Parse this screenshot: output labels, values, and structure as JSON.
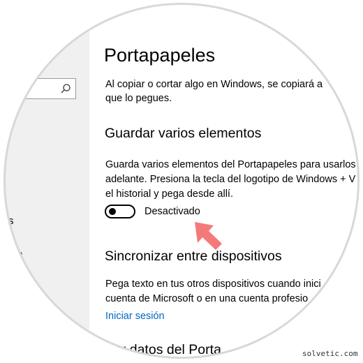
{
  "sidebar": {
    "search": {
      "placeholder": ""
    },
    "items": [
      {
        "label": "s"
      },
      {
        "label": "n"
      }
    ]
  },
  "main": {
    "title": "Portapapeles",
    "intro_lines": [
      "Al copiar o cortar algo en Windows, se copiará a",
      "que lo pegues."
    ],
    "history": {
      "title": "Guardar varios elementos",
      "description_lines": [
        "Guarda varios elementos del Portapapeles para usarlos",
        "adelante. Presiona la tecla del logotipo de Windows + V",
        "el historial y pega desde allí."
      ],
      "toggle_state": "Desactivado",
      "toggle_on": false
    },
    "sync": {
      "title": "Sincronizar entre dispositivos",
      "description_lines": [
        "Pega texto en tus otros dispositivos cuando inici",
        "cuenta de Microsoft o en una cuenta profesio"
      ],
      "link": "Iniciar sesión"
    },
    "clear": {
      "title": "rrar datos del Porta"
    }
  },
  "colors": {
    "sidebar_bg": "#f0f0f0",
    "link": "#0067c0",
    "arrow": "#f47a7a",
    "ring": "#d8d8d8"
  },
  "icons": [
    "search-icon",
    "arrow-icon"
  ],
  "watermark": "solvetic.com"
}
